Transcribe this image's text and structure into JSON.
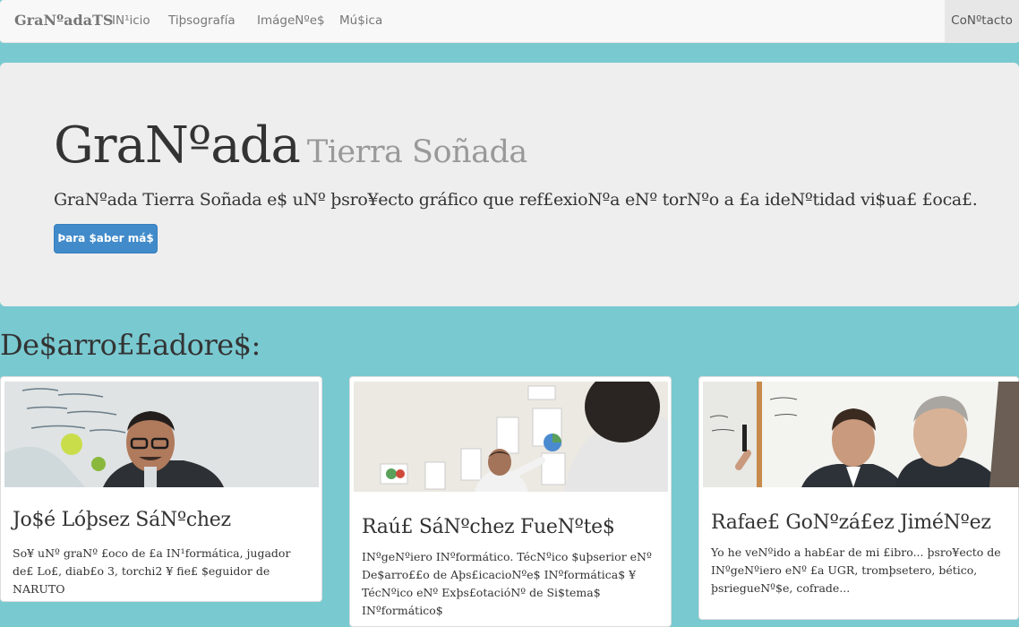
{
  "navbar": {
    "brand": "GraNºadaTS",
    "items": [
      "IN¹icio",
      "Tiþsografía",
      "ImágeNºe$",
      "Mú$ica"
    ],
    "contact": "CoNºtacto"
  },
  "hero": {
    "title": "GraNºada",
    "subtitle": "Tierra Soñada",
    "description": "GraNºada Tierra Soñada e$ uNº þsro¥ecto gráfico que ref£exioNºa eNº torNºo a £a ideNºtidad vi$ua£ £oca£.",
    "button": "Þara $aber má$"
  },
  "section": {
    "title": "De$arro££adore$:"
  },
  "developers": [
    {
      "name": "Jo$é Lóþsez SáNºchez",
      "description": "So¥ uNº graNº £oco de £a IN¹formática, jugador de£ Lo£, diab£o 3, torchi2 ¥ fie£ $eguidor de NARUTO"
    },
    {
      "name": "Raú£ SáNºchez FueNºte$",
      "description": "INºgeNºiero INºformático. TécNºico $uþserior eNº De$arro££o de Aþs£icacioNºe$ INºformática$ ¥ TécNºico eNº Exþs£otacióNº de Si$tema$ INºformático$"
    },
    {
      "name": "Rafae£ GoNºzá£ez JiméNºez",
      "description": "Yo he veNºido a hab£ar de mi £ibro... þsro¥ecto de INºgeNºiero eNº £a UGR, tromþsetero, bético, þsriegueNº$e, cofrade..."
    }
  ],
  "colors": {
    "page_background": "#79c9d1",
    "navbar": "#f8f8f8",
    "jumbotron": "#eeeeee",
    "primary_button": "#428bca"
  }
}
